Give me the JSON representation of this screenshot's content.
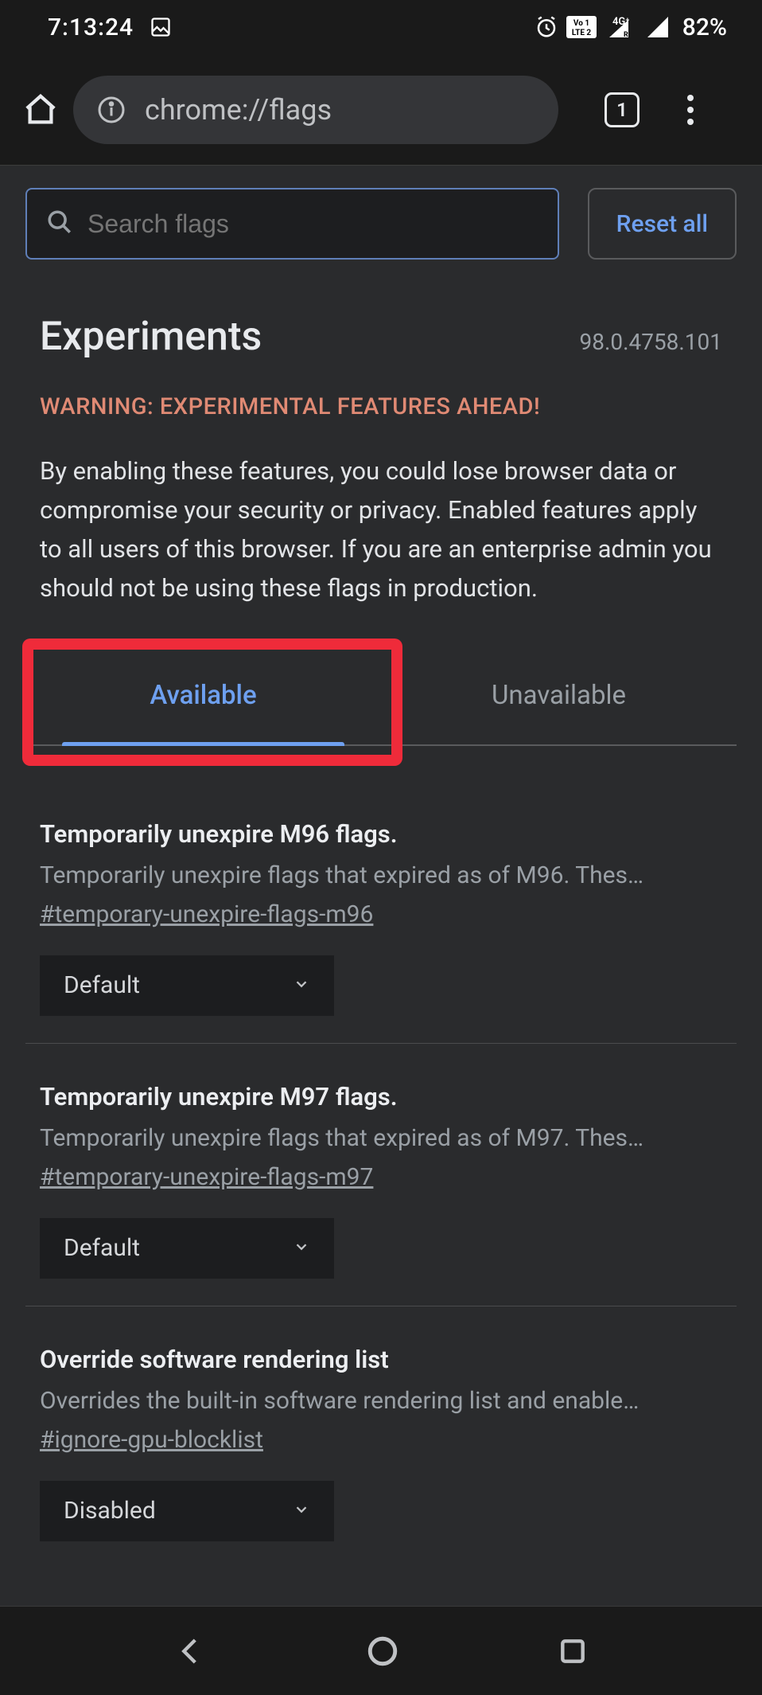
{
  "status": {
    "time": "7:13:24",
    "battery": "82%"
  },
  "browser": {
    "url": "chrome://flags",
    "tab_count": "1"
  },
  "search": {
    "placeholder": "Search flags"
  },
  "reset_label": "Reset all",
  "page": {
    "title": "Experiments",
    "version": "98.0.4758.101",
    "warning_heading": "WARNING: EXPERIMENTAL FEATURES AHEAD!",
    "warning_body": "By enabling these features, you could lose browser data or compromise your security or privacy. Enabled features apply to all users of this browser. If you are an enterprise admin you should not be using these flags in production."
  },
  "tabs": {
    "available": "Available",
    "unavailable": "Unavailable"
  },
  "flags": [
    {
      "title": "Temporarily unexpire M96 flags.",
      "desc": "Temporarily unexpire flags that expired as of M96. Thes…",
      "hash": "#temporary-unexpire-flags-m96",
      "value": "Default"
    },
    {
      "title": "Temporarily unexpire M97 flags.",
      "desc": "Temporarily unexpire flags that expired as of M97. Thes…",
      "hash": "#temporary-unexpire-flags-m97",
      "value": "Default"
    },
    {
      "title": "Override software rendering list",
      "desc": "Overrides the built-in software rendering list and enable…",
      "hash": "#ignore-gpu-blocklist",
      "value": "Disabled"
    }
  ]
}
